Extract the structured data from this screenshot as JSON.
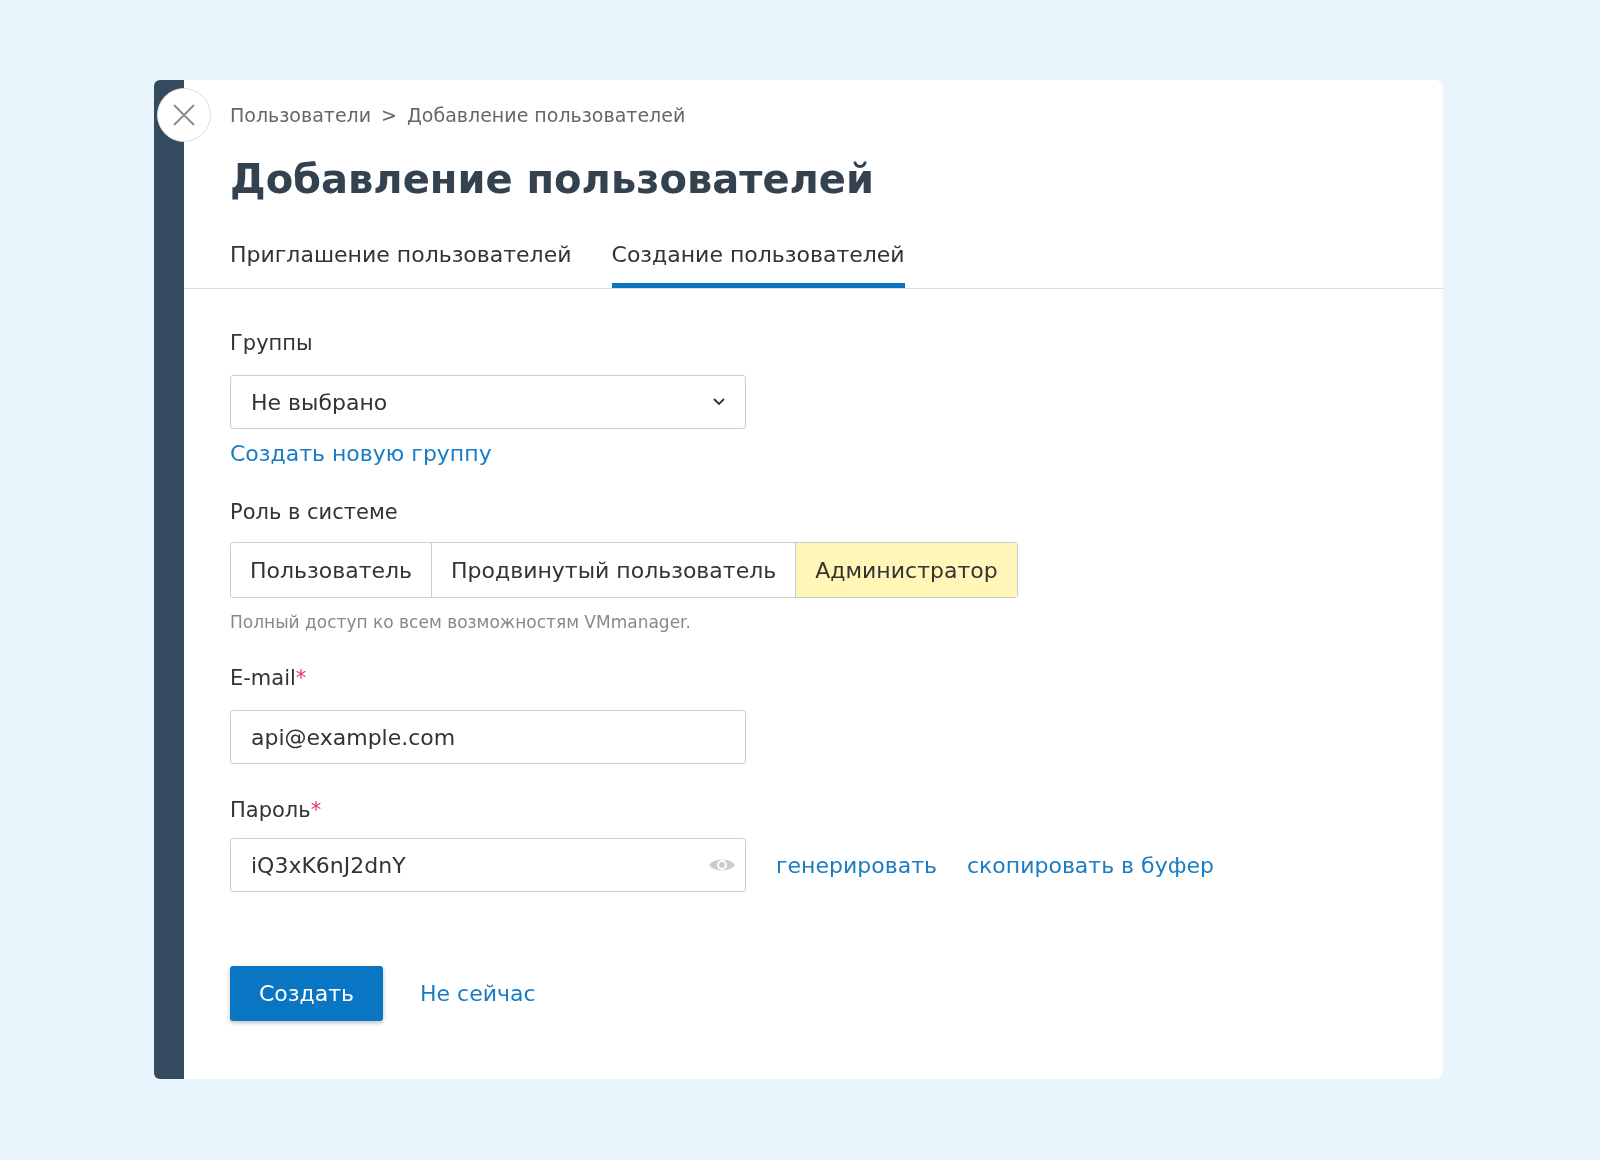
{
  "breadcrumb": {
    "items": [
      "Пользователи",
      "Добавление пользователей"
    ],
    "separator": ">"
  },
  "title": "Добавление пользователей",
  "tabs": [
    {
      "label": "Приглашение пользователей",
      "selected": false
    },
    {
      "label": "Создание пользователей",
      "selected": true
    }
  ],
  "groups": {
    "label": "Группы",
    "value": "Не выбрано",
    "link": "Создать новую группу"
  },
  "role": {
    "label": "Роль в системе",
    "options": [
      {
        "label": "Пользователь",
        "selected": false
      },
      {
        "label": "Продвинутый пользователь",
        "selected": false
      },
      {
        "label": "Администратор",
        "selected": true
      }
    ],
    "hint": "Полный доступ ко всем возможностям VMmanager."
  },
  "email": {
    "label": "E-mail",
    "required_mark": "*",
    "value": "api@example.com"
  },
  "password": {
    "label": "Пароль",
    "required_mark": "*",
    "value": "iQ3xK6nJ2dnY",
    "links": [
      "генерировать",
      "скопировать в буфер"
    ]
  },
  "buttons": {
    "primary": "Создать",
    "secondary": "Не сейчас"
  }
}
